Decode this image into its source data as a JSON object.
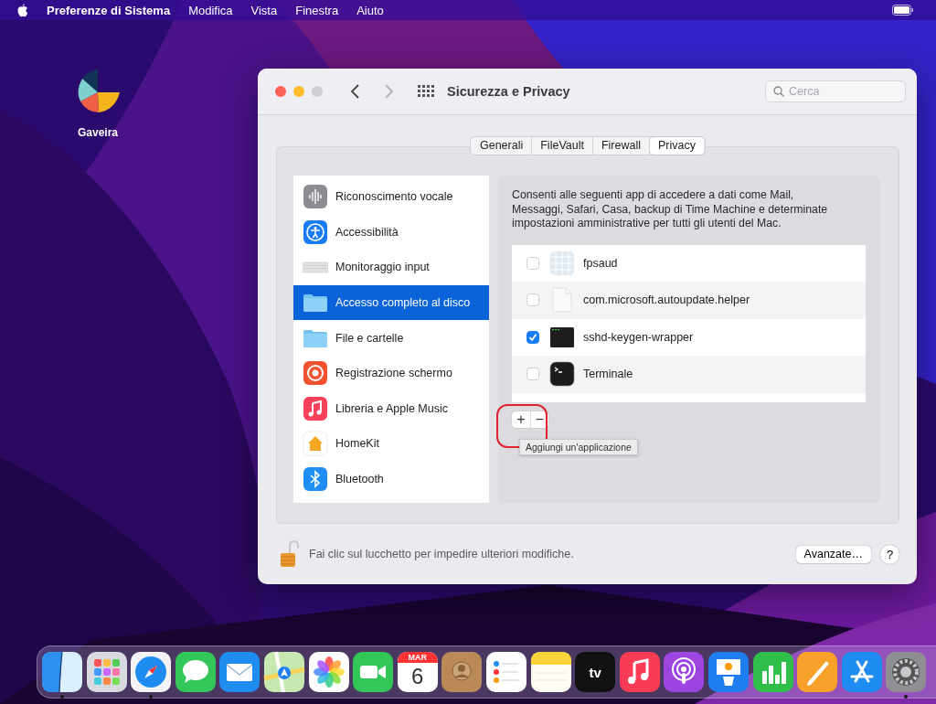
{
  "menu_bar": {
    "app_name": "Preferenze di Sistema",
    "menus": [
      "Modifica",
      "Vista",
      "Finestra",
      "Aiuto"
    ]
  },
  "desktop_icons": [
    {
      "label": "Gaveira"
    }
  ],
  "window": {
    "title": "Sicurezza e Privacy",
    "zoom_enabled": false,
    "back_enabled": true,
    "forward_enabled": false,
    "search": {
      "placeholder": "Cerca"
    }
  },
  "tabs": [
    {
      "label": "Generali",
      "selected": false
    },
    {
      "label": "FileVault",
      "selected": false
    },
    {
      "label": "Firewall",
      "selected": false
    },
    {
      "label": "Privacy",
      "selected": true
    }
  ],
  "sidebar": {
    "items": [
      {
        "label": "Riconoscimento vocale",
        "kind": "speech",
        "selected": false
      },
      {
        "label": "Accessibilità",
        "kind": "accessibility",
        "selected": false
      },
      {
        "label": "Monitoraggio input",
        "kind": "keyboard",
        "selected": false
      },
      {
        "label": "Accesso completo al disco",
        "kind": "folder",
        "selected": true
      },
      {
        "label": "File e cartelle",
        "kind": "folder",
        "selected": false
      },
      {
        "label": "Registrazione schermo",
        "kind": "record",
        "selected": false
      },
      {
        "label": "Libreria e Apple Music",
        "kind": "music",
        "selected": false
      },
      {
        "label": "HomeKit",
        "kind": "home",
        "selected": false
      },
      {
        "label": "Bluetooth",
        "kind": "bluetooth",
        "selected": false
      }
    ]
  },
  "description": "Consenti alle seguenti app di accedere a dati come Mail, Messaggi, Safari, Casa, backup di Time Machine e determinate impostazioni amministrative per tutti gli utenti del Mac.",
  "app_list": {
    "rows": [
      {
        "name": "fpsaud",
        "kind": "grid",
        "checked": false
      },
      {
        "name": "com.microsoft.autoupdate.helper",
        "kind": "document",
        "checked": false
      },
      {
        "name": "sshd-keygen-wrapper",
        "kind": "exec",
        "checked": true
      },
      {
        "name": "Terminale",
        "kind": "terminal",
        "checked": false
      }
    ]
  },
  "add_button": {
    "label": "+",
    "highlighted": true
  },
  "remove_button": {
    "label": "−"
  },
  "tooltip": "Aggiungi un'applicazione",
  "footer": {
    "lock_open": true,
    "message": "Fai clic sul lucchetto per impedire ulteriori modifiche.",
    "advanced_button": "Avanzate…",
    "help_button": "?"
  },
  "dock": [
    {
      "kind": "finder",
      "running": true
    },
    {
      "kind": "launchpad",
      "running": false
    },
    {
      "kind": "safari",
      "running": true
    },
    {
      "kind": "messages",
      "running": false
    },
    {
      "kind": "mail",
      "running": false
    },
    {
      "kind": "maps",
      "running": false
    },
    {
      "kind": "photos",
      "running": false
    },
    {
      "kind": "facetime",
      "running": false
    },
    {
      "kind": "calendar",
      "running": false,
      "month": "MAR",
      "day": "6"
    },
    {
      "kind": "contacts",
      "running": false
    },
    {
      "kind": "reminders",
      "running": false
    },
    {
      "kind": "notes",
      "running": false
    },
    {
      "kind": "tv",
      "running": false,
      "label": "tv"
    },
    {
      "kind": "music",
      "running": false
    },
    {
      "kind": "podcasts",
      "running": false
    },
    {
      "kind": "keynote",
      "running": false
    },
    {
      "kind": "numbers",
      "running": false
    },
    {
      "kind": "pages",
      "running": false
    },
    {
      "kind": "appstore",
      "running": false
    },
    {
      "kind": "settings",
      "running": true
    }
  ]
}
